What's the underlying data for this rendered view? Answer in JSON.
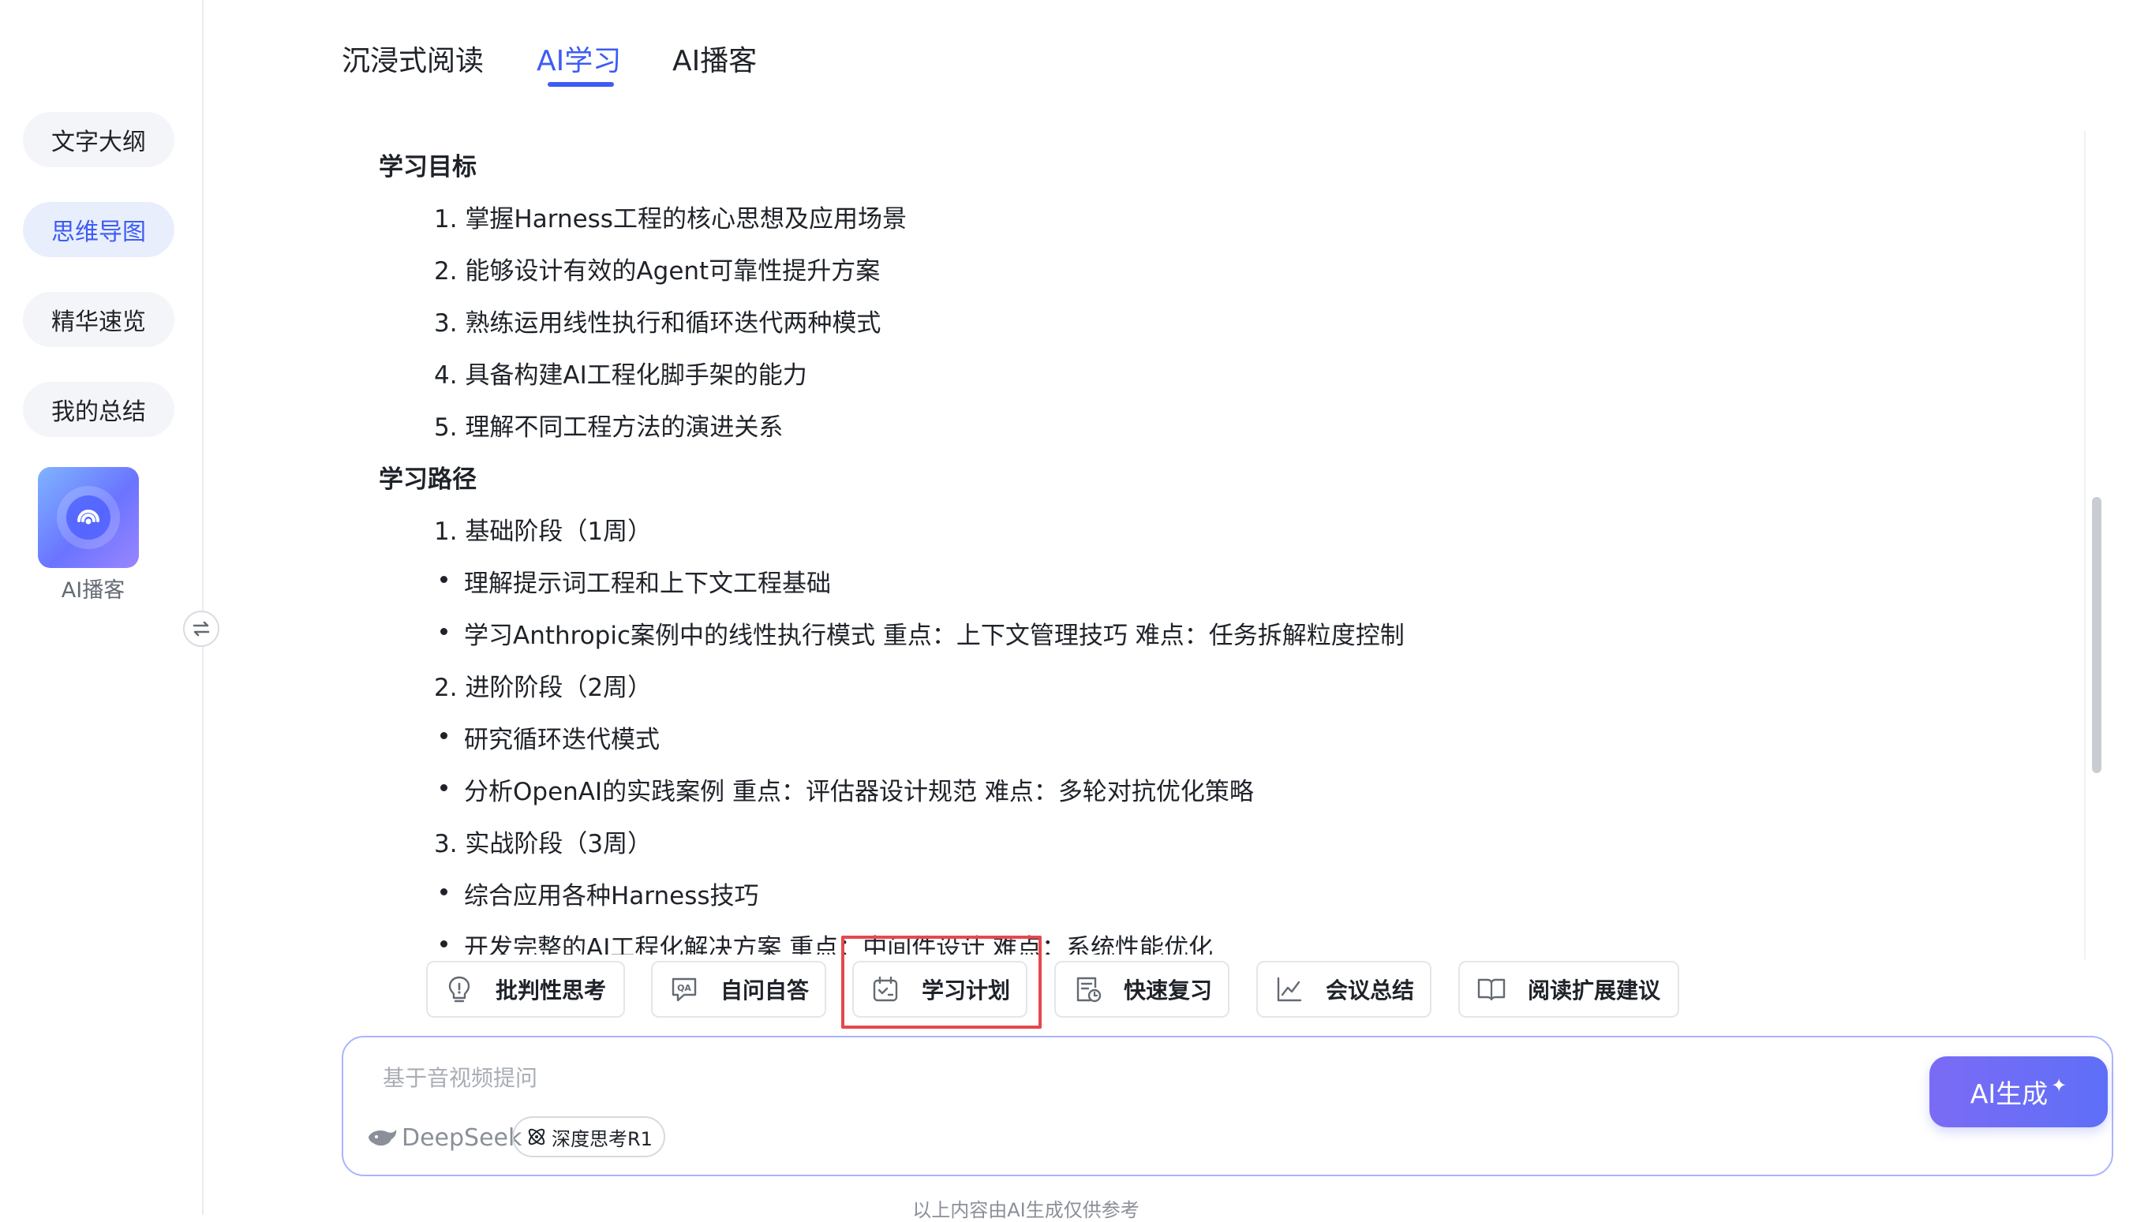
{
  "sidebar": {
    "items": [
      {
        "label": "文字大纲",
        "active": false
      },
      {
        "label": "思维导图",
        "active": true
      },
      {
        "label": "精华速览",
        "active": false
      },
      {
        "label": "我的总结",
        "active": false
      }
    ],
    "podcast_caption": "AI播客",
    "icons": {
      "podcast": "podcast-broadcast-icon",
      "toggle": "swap-arrows-icon"
    }
  },
  "tabs": [
    {
      "label": "沉浸式阅读",
      "active": false
    },
    {
      "label": "AI学习",
      "active": true
    },
    {
      "label": "AI播客",
      "active": false
    }
  ],
  "content": {
    "lines": [
      {
        "type": "heading",
        "text": "学习目标"
      },
      {
        "type": "item",
        "text": "1. 掌握Harness工程的核心思想及应用场景"
      },
      {
        "type": "item",
        "text": "2. 能够设计有效的Agent可靠性提升方案"
      },
      {
        "type": "item",
        "text": "3. 熟练运用线性执行和循环迭代两种模式"
      },
      {
        "type": "item",
        "text": "4. 具备构建AI工程化脚手架的能力"
      },
      {
        "type": "item",
        "text": "5. 理解不同工程方法的演进关系"
      },
      {
        "type": "heading",
        "text": "学习路径"
      },
      {
        "type": "item",
        "text": "1. 基础阶段（1周）"
      },
      {
        "type": "bullet",
        "text": "理解提示词工程和上下文工程基础"
      },
      {
        "type": "bullet",
        "text": "学习Anthropic案例中的线性执行模式 重点：上下文管理技巧 难点：任务拆解粒度控制"
      },
      {
        "type": "item",
        "text": "2. 进阶阶段（2周）"
      },
      {
        "type": "bullet",
        "text": "研究循环迭代模式"
      },
      {
        "type": "bullet",
        "text": "分析OpenAI的实践案例 重点：评估器设计规范 难点：多轮对抗优化策略"
      },
      {
        "type": "item",
        "text": "3. 实战阶段（3周）"
      },
      {
        "type": "bullet",
        "text": "综合应用各种Harness技巧"
      },
      {
        "type": "bullet",
        "text": "开发完整的AI工程化解决方案 重点：中间件设计 难点：系统性能优化"
      }
    ]
  },
  "chips": [
    {
      "label": "批判性思考",
      "icon": "lightbulb-icon"
    },
    {
      "label": "自问自答",
      "icon": "qa-chat-icon"
    },
    {
      "label": "学习计划",
      "icon": "calendar-plan-icon",
      "highlighted": true
    },
    {
      "label": "快速复习",
      "icon": "review-clock-icon"
    },
    {
      "label": "会议总结",
      "icon": "line-chart-icon"
    },
    {
      "label": "阅读扩展建议",
      "icon": "open-book-icon"
    }
  ],
  "input": {
    "placeholder": "基于音视频提问",
    "value": "",
    "model_label": "DeepSeek",
    "deep_think_label": "深度思考R1",
    "generate_label": "AI生成",
    "generate_spark": "✦"
  },
  "footer_note": "以上内容由AI生成仅供参考",
  "colors": {
    "accent": "#3d5cf5",
    "highlight_border": "#e5484d",
    "generate_gradient_start": "#7b6bf5",
    "generate_gradient_end": "#5e6ff7"
  }
}
